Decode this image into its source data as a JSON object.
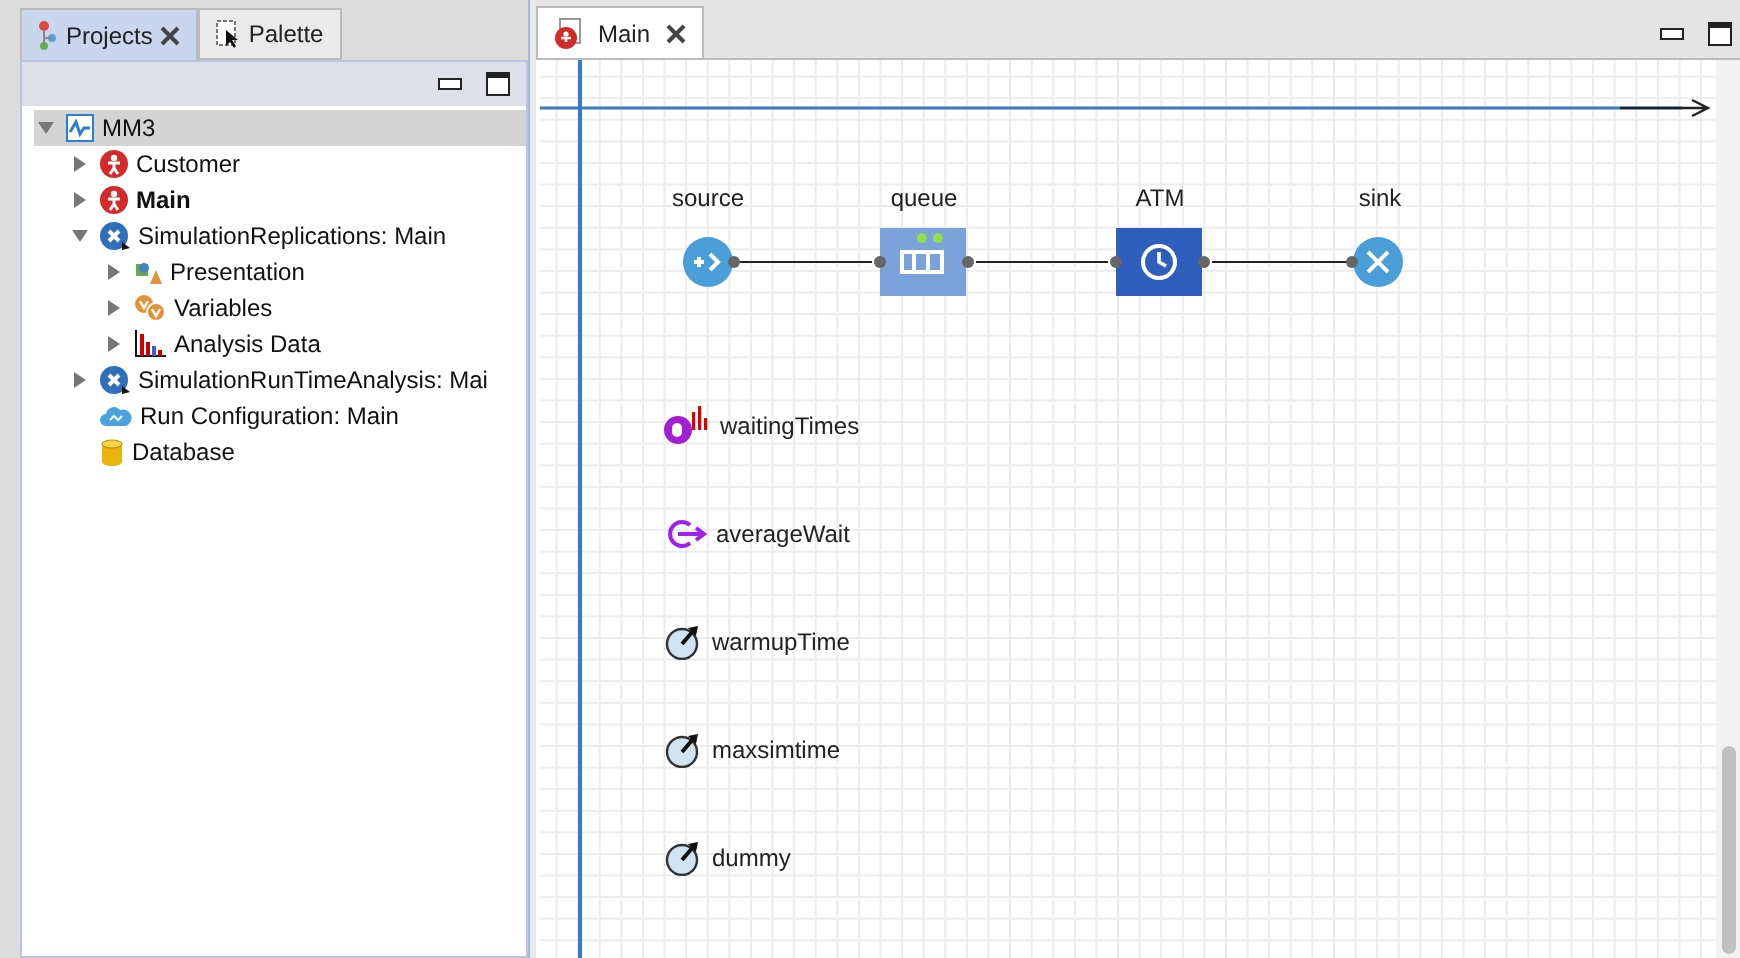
{
  "left_panel": {
    "tabs": [
      {
        "label": "Projects",
        "selected": true,
        "closable": true
      },
      {
        "label": "Palette",
        "selected": false,
        "closable": false
      }
    ],
    "tree": [
      {
        "label": "MM3",
        "kind": "model",
        "expanded": true,
        "selected": true,
        "bold": false,
        "children": [
          {
            "label": "Customer",
            "kind": "agent",
            "expanded": false,
            "selected": false,
            "bold": false
          },
          {
            "label": "Main",
            "kind": "agent",
            "expanded": false,
            "selected": false,
            "bold": true
          },
          {
            "label": "SimulationReplications: Main",
            "kind": "experiment",
            "expanded": true,
            "selected": false,
            "bold": false,
            "children": [
              {
                "label": "Presentation",
                "kind": "presentation",
                "expanded": false,
                "selected": false,
                "bold": false
              },
              {
                "label": "Variables",
                "kind": "variables",
                "expanded": false,
                "selected": false,
                "bold": false
              },
              {
                "label": "Analysis Data",
                "kind": "analysis",
                "expanded": false,
                "selected": false,
                "bold": false
              }
            ]
          },
          {
            "label": "SimulationRunTimeAnalysis: Mai",
            "kind": "experiment",
            "expanded": false,
            "selected": false,
            "bold": false
          },
          {
            "label": "Run Configuration: Main",
            "kind": "run",
            "selected": false,
            "bold": false
          },
          {
            "label": "Database",
            "kind": "database",
            "selected": false,
            "bold": false
          }
        ]
      }
    ]
  },
  "editor": {
    "tab": {
      "label": "Main",
      "selected": true
    },
    "flow": [
      {
        "label": "source",
        "kind": "source"
      },
      {
        "label": "queue",
        "kind": "queue"
      },
      {
        "label": "ATM",
        "kind": "delay"
      },
      {
        "label": "sink",
        "kind": "sink"
      }
    ],
    "elements": [
      {
        "label": "waitingTimes",
        "kind": "dataset"
      },
      {
        "label": "averageWait",
        "kind": "statistics"
      },
      {
        "label": "warmupTime",
        "kind": "parameter"
      },
      {
        "label": "maxsimtime",
        "kind": "parameter"
      },
      {
        "label": "dummy",
        "kind": "parameter"
      }
    ]
  }
}
